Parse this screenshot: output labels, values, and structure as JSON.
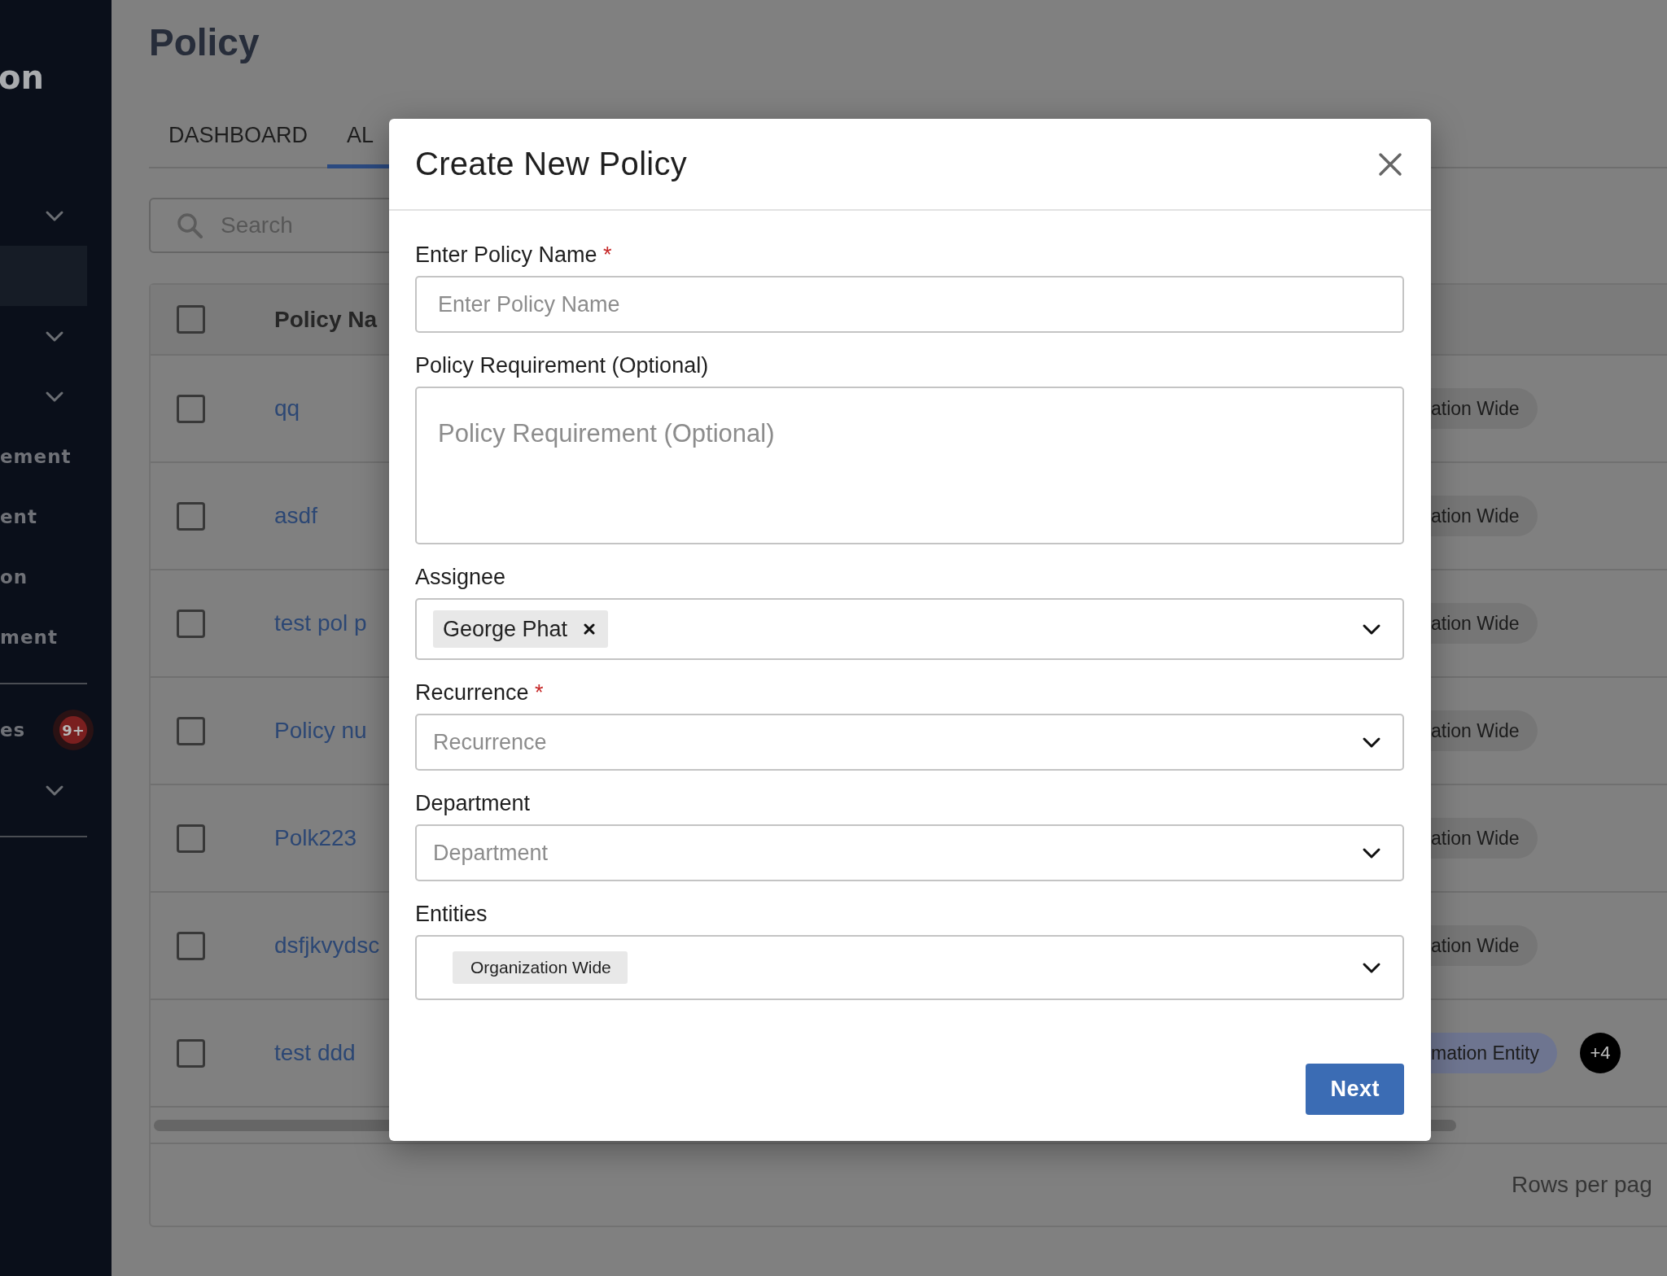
{
  "sidebar": {
    "title": "on",
    "items": [
      {
        "kind": "group"
      },
      {
        "kind": "item",
        "selected": true
      },
      {
        "kind": "group"
      },
      {
        "kind": "group"
      },
      {
        "kind": "item",
        "label": "ement",
        "selected": false
      },
      {
        "kind": "item",
        "label": "ent",
        "selected": false
      },
      {
        "kind": "item",
        "label": "on",
        "selected": false
      },
      {
        "kind": "item",
        "label": "ment",
        "selected": false
      },
      {
        "kind": "divider"
      },
      {
        "kind": "item",
        "label": "es",
        "badge": "9+",
        "selected": false
      },
      {
        "kind": "group"
      },
      {
        "kind": "divider"
      }
    ]
  },
  "page": {
    "title": "Policy",
    "tabs": [
      {
        "label": "DASHBOARD",
        "selected": false
      },
      {
        "label": "AL",
        "selected": true
      }
    ],
    "search": {
      "placeholder": "Search"
    },
    "table": {
      "select_all": {
        "checked": false
      },
      "columns": [
        {
          "label": "Policy Na"
        }
      ],
      "rows": [
        {
          "name": "qq",
          "checked": false,
          "entity": {
            "label": "ation Wide",
            "color": "#767676"
          }
        },
        {
          "name": "asdf",
          "checked": false,
          "entity": {
            "label": "ation Wide",
            "color": "#767676"
          }
        },
        {
          "name": "test pol p",
          "checked": false,
          "entity": {
            "label": "ation Wide",
            "color": "#767676"
          }
        },
        {
          "name": "Policy nu",
          "checked": false,
          "entity": {
            "label": "ation Wide",
            "color": "#767676"
          }
        },
        {
          "name": "Polk223",
          "checked": false,
          "entity": {
            "label": "ation Wide",
            "color": "#767676"
          }
        },
        {
          "name": "dsfjkvydsc",
          "checked": false,
          "entity": {
            "label": "ation Wide",
            "color": "#767676"
          }
        },
        {
          "name": "test ddd",
          "checked": false,
          "entity": {
            "label": "mation Entity",
            "color": "#6e7590"
          },
          "more": "+4"
        }
      ],
      "footer": {
        "rows_per_page": "Rows per pag"
      }
    }
  },
  "modal": {
    "title": "Create New Policy",
    "fields": [
      {
        "kind": "text",
        "label": "Enter Policy Name",
        "required_mark": "*",
        "placeholder": "Enter Policy Name"
      },
      {
        "kind": "textarea",
        "label": "Policy Requirement (Optional)",
        "placeholder": "Policy Requirement (Optional)"
      },
      {
        "kind": "select",
        "label": "Assignee",
        "chips": [
          {
            "label": "George Phat",
            "removable": true
          }
        ]
      },
      {
        "kind": "select",
        "label": "Recurrence",
        "required_mark": "*",
        "placeholder": "Recurrence"
      },
      {
        "kind": "select",
        "label": "Department",
        "placeholder": "Department"
      },
      {
        "kind": "select",
        "label": "Entities",
        "chips": [
          {
            "label": "Organization Wide",
            "removable": false
          }
        ]
      }
    ],
    "next_button": "Next"
  }
}
